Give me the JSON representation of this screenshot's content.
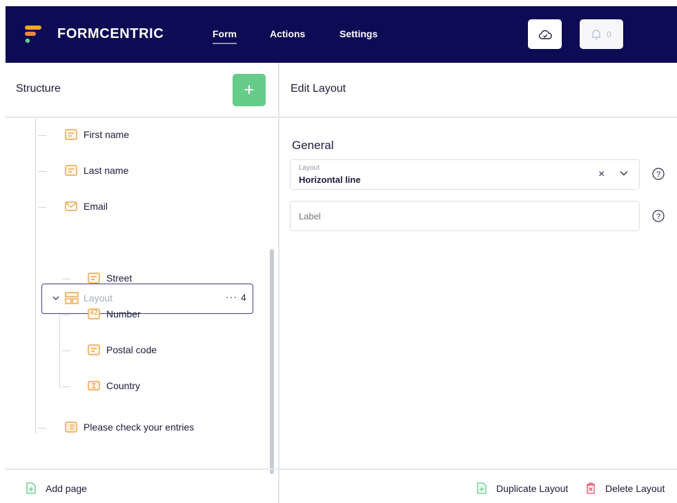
{
  "brand": {
    "name": "FORMCENTRIC"
  },
  "nav": {
    "items": [
      "Form",
      "Actions",
      "Settings"
    ],
    "active": "Form"
  },
  "notifications": {
    "count": "0"
  },
  "icons": {
    "cloud": "cloud-check-icon",
    "bell": "bell-icon",
    "add": "plus-icon"
  },
  "colors": {
    "topbar": "#0d0b54",
    "accent_green": "#66cc8a",
    "icon_orange": "#f0a040",
    "delete_red": "#e8556a"
  },
  "structure": {
    "title": "Structure",
    "add_symbol": "+",
    "items": [
      {
        "label": "First name",
        "icon": "text-field-icon"
      },
      {
        "label": "Last name",
        "icon": "text-field-icon"
      },
      {
        "label": "Email",
        "icon": "email-icon"
      },
      {
        "label": "Layout",
        "icon": "layout-icon",
        "selected": true,
        "count": "4",
        "more": "···"
      },
      {
        "label": "Street",
        "icon": "text-field-icon"
      },
      {
        "label": "Number",
        "icon": "number-field-icon",
        "icon_text": "42"
      },
      {
        "label": "Postal code",
        "icon": "text-field-icon"
      },
      {
        "label": "Country",
        "icon": "select-field-icon"
      },
      {
        "label": "Please check your entries",
        "icon": "summary-icon"
      }
    ],
    "add_page": "Add page"
  },
  "edit": {
    "title": "Edit Layout",
    "section": "General",
    "layout_field": {
      "label": "Layout",
      "value": "Horizontal line",
      "clear": "×"
    },
    "label_field": {
      "placeholder": "Label"
    },
    "help": "?",
    "duplicate": "Duplicate Layout",
    "delete": "Delete Layout"
  }
}
